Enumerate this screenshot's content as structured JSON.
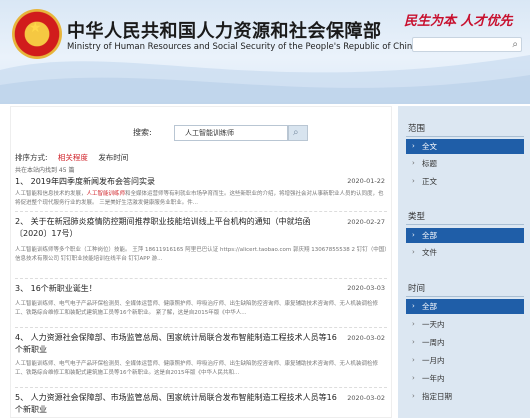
{
  "header": {
    "title": "中华人民共和国人力资源和社会保障部",
    "subtitle": "Ministry of Human Resources and Social Security of the People's Republic of China",
    "slogan": "民生为本 人才优先"
  },
  "search": {
    "label": "搜索:",
    "value": "人工智能训练师"
  },
  "sort": {
    "label": "排序方式:",
    "options": [
      "相关程度",
      "发布时间"
    ],
    "active": "相关程度"
  },
  "count_text": "共在本站内找到 45 篇",
  "results": [
    {
      "title": "1、  2019年四季度新闻发布会答问实录",
      "date": "2020-01-22",
      "snippet_pre": "人工智能和信息技术的发展，",
      "snippet_hl": "人工智能训练师",
      "snippet_post": "和全媒体运营师等有利就业市场孕育而生。这些新职业的介绍，将增强社会对从事新职业人员的认同度，也将促进整个现代服务行业的发展。    三是美好生活激发健康服务业职业。件..."
    },
    {
      "title": "2、  关于在新冠肺炎疫情防控期间推荐职业技能培训线上平台机构的通知（中就培函〔2020〕17号）",
      "date": "2020-02-27",
      "snippet_pre": "人工智能训练师等多个职业（工种岗位）技能。    王萍    18611916165    阿里巴巴认证    https://alicert.taobao.com    郭庆翔    13067855538    2    钉钉（中国）信息技术有限公司    钉钉职业技能培训在线平台    钉钉APP    游...",
      "snippet_hl": "",
      "snippet_post": ""
    },
    {
      "title": "3、  16个新职业诞生！",
      "date": "2020-03-03",
      "snippet_pre": "人工智能训练师、电气电子产品环保检测员、全媒体运营师、健康照护师、呼吸治疗师、出生缺陷防控咨询师、康复辅助技术咨询师、无人机装调检修工、铁路综合维修工和装配式建筑施工员等16个新职业。    紧了解，这是自2015年版《中华人...",
      "snippet_hl": "",
      "snippet_post": ""
    },
    {
      "title": "4、  人力资源社会保障部、市场监管总局、国家统计局联合发布智能制造工程技术人员等16个新职业",
      "date": "2020-03-02",
      "snippet_pre": "人工智能训练师、电气电子产品环保检测员、全媒体运营师、健康照护师、呼吸治疗师、出生缺陷防控咨询师、康复辅助技术咨询师、无人机装调检修工、铁路综合维修工和装配式建筑施工员等16个新职业。这是自2015年版《中华人民共和...",
      "snippet_hl": "",
      "snippet_post": ""
    },
    {
      "title": "5、  人力资源社会保障部、市场监管总局、国家统计局联合发布智能制造工程技术人员等16个新职业",
      "date": "2020-03-02",
      "snippet_pre": "",
      "snippet_hl": "",
      "snippet_post": ""
    }
  ],
  "sidebar": {
    "scope": {
      "title": "范围",
      "options": [
        "全文",
        "标题",
        "正文"
      ],
      "selected": 0
    },
    "type": {
      "title": "类型",
      "options": [
        "全部",
        "文件"
      ],
      "selected": 0
    },
    "time": {
      "title": "时间",
      "options": [
        "全部",
        "一天内",
        "一周内",
        "一月内",
        "一年内",
        "指定日期"
      ],
      "selected": 0
    }
  },
  "colors": {
    "accent": "#1f5ea8",
    "highlight": "#d0232a",
    "sidebar_bg": "#dce7f2"
  },
  "icons": [
    "national-emblem-icon",
    "search-icon",
    "chevron-right-icon"
  ]
}
